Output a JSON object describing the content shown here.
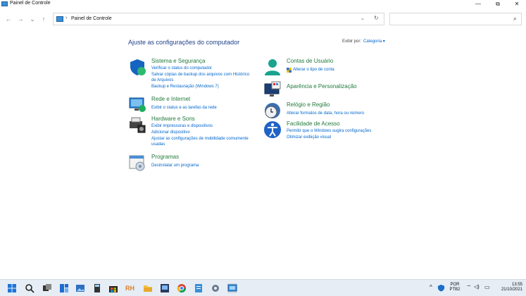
{
  "window": {
    "title": "Painel de Controle",
    "minimize": "—",
    "maximize": "⧉",
    "close": "✕"
  },
  "nav": {
    "back": "←",
    "forward": "→",
    "dropdown": "⌄",
    "up": "↑",
    "breadcrumb": "Painel de Controle",
    "separator": "›",
    "address_dropdown": "⌄",
    "refresh": "↻",
    "search_placeholder": "",
    "search_icon": "⌕"
  },
  "main": {
    "heading": "Ajuste as configurações do computador",
    "view_by_label": "Exibir por:",
    "view_by_value": "Categoria ▾",
    "categories_left": [
      {
        "title": "Sistema e Segurança",
        "links": [
          "Verificar o status do computador",
          "Salvar cópias de backup dos arquivos com Histórico",
          "de Arquivos",
          "Backup e Restauração (Windows 7)"
        ]
      },
      {
        "title": "Rede e Internet",
        "links": [
          "Exibir o status e as tarefas da rede"
        ]
      },
      {
        "title": "Hardware e Sons",
        "links": [
          "Exibir impressoras e dispositivos",
          "Adicionar dispositivo",
          "Ajustar as configurações de mobilidade comumente",
          "usadas"
        ]
      },
      {
        "title": "Programas",
        "links": [
          "Desinstalar um programa"
        ]
      }
    ],
    "categories_right": [
      {
        "title": "Contas de Usuário",
        "links": [
          "Alterar o tipo de conta"
        ]
      },
      {
        "title": "Aparência e Personalização",
        "links": []
      },
      {
        "title": "Relógio e Região",
        "links": [
          "Alterar formatos de data, hora ou número"
        ]
      },
      {
        "title": "Facilidade de Acesso",
        "links": [
          "Permitir que o Windows sugira configurações",
          "Otimizar exibição visual"
        ]
      }
    ]
  },
  "taskbar": {
    "lang_top": "POR",
    "lang_bottom": "PTB2",
    "time": "13:55",
    "date": "21/10/2021",
    "rh_label": "RH",
    "tray_chevron": "^",
    "tray_wifi": "⌔",
    "tray_volume": "◁)",
    "tray_battery": "▭"
  },
  "colors": {
    "accent": "#0066cc",
    "heading": "#1e3f8a",
    "category_title": "#227a3c",
    "taskbar": "#e6edf5"
  }
}
